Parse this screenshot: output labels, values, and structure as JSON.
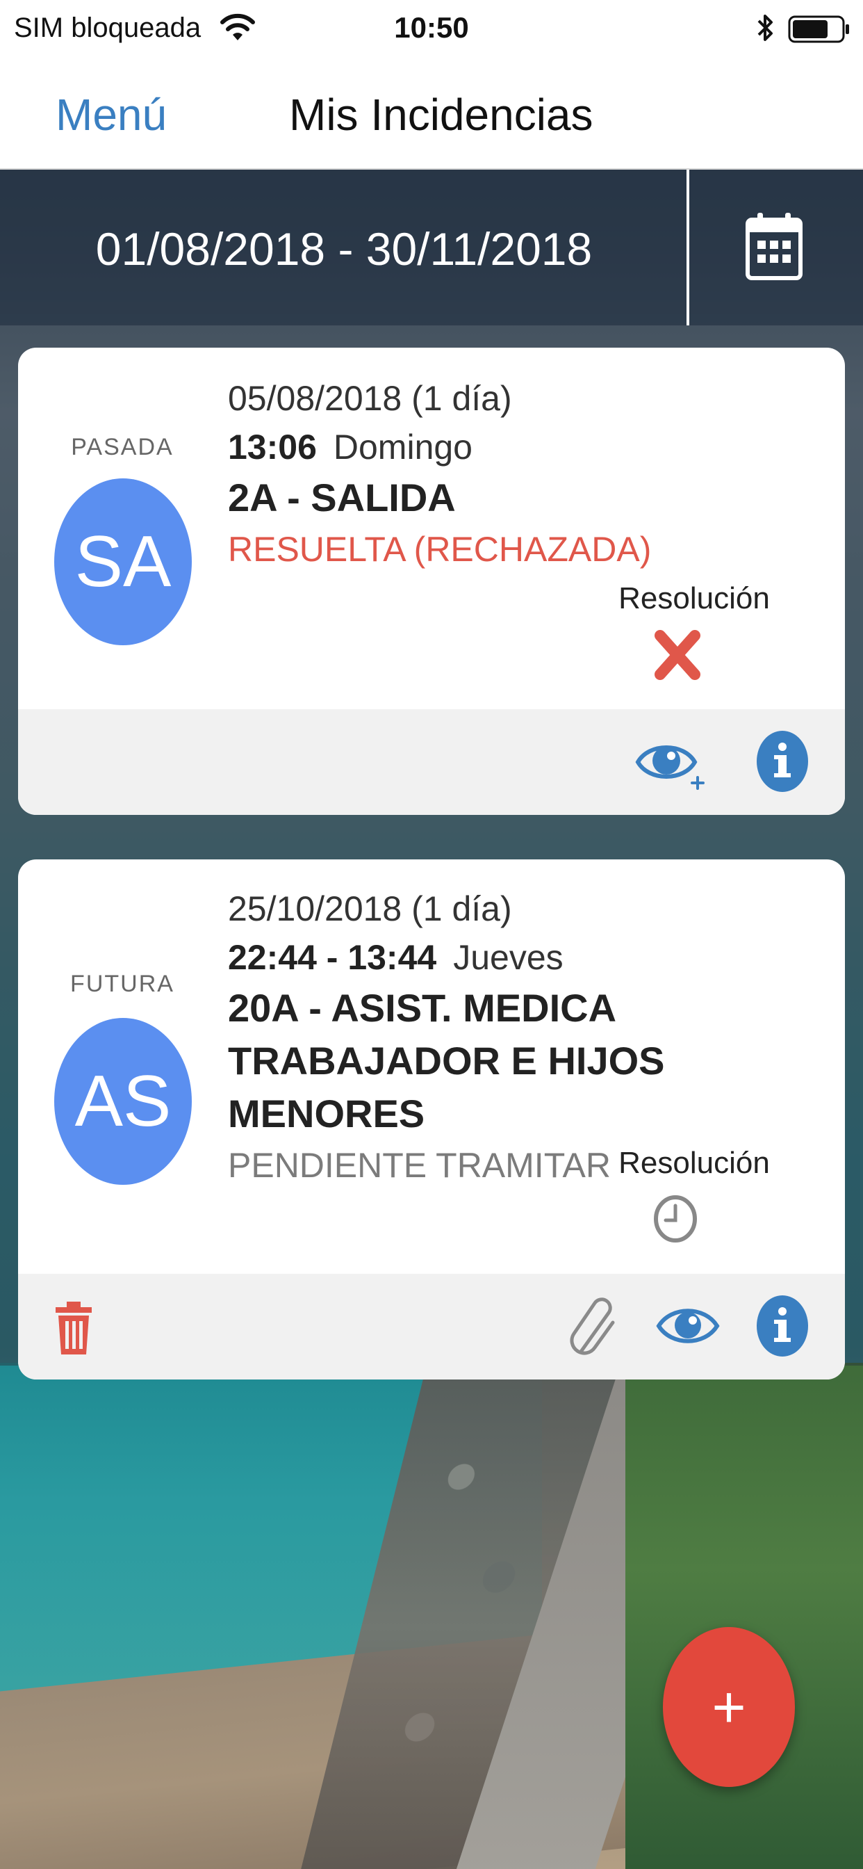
{
  "status_bar": {
    "carrier": "SIM bloqueada",
    "time": "10:50"
  },
  "nav": {
    "menu_label": "Menú",
    "title": "Mis Incidencias"
  },
  "date_range": {
    "text": "01/08/2018 - 30/11/2018",
    "icon": "calendar-icon"
  },
  "incidents": [
    {
      "state_label": "PASADA",
      "initials": "SA",
      "date": "05/08/2018 (1 día)",
      "time": "13:06",
      "weekday": "Domingo",
      "type": "2A - SALIDA",
      "status": "RESUELTA (RECHAZADA)",
      "status_color": "#e0574a",
      "resolution_label": "Resolución",
      "resolution_icon": "rejected-x-icon",
      "actions": [
        "view-plus-icon",
        "info-icon"
      ]
    },
    {
      "state_label": "FUTURA",
      "initials": "AS",
      "date": "25/10/2018 (1 día)",
      "time": "22:44 - 13:44",
      "weekday": "Jueves",
      "type_line1": "20A - ASIST. MEDICA",
      "type_line2": "TRABAJADOR E HIJOS MENORES",
      "status": "PENDIENTE TRAMITAR",
      "status_color": "#7b7b7b",
      "resolution_label": "Resolución",
      "resolution_icon": "clock-icon",
      "actions": [
        "trash-icon",
        "attachment-icon",
        "view-icon",
        "info-icon"
      ]
    }
  ],
  "fab": {
    "label": "+",
    "color": "#e2483c"
  },
  "colors": {
    "accent_blue": "#3a7fc1",
    "avatar_blue": "#5b8ff0",
    "icon_blue": "#3a7fc1",
    "danger_red": "#e0574a"
  }
}
